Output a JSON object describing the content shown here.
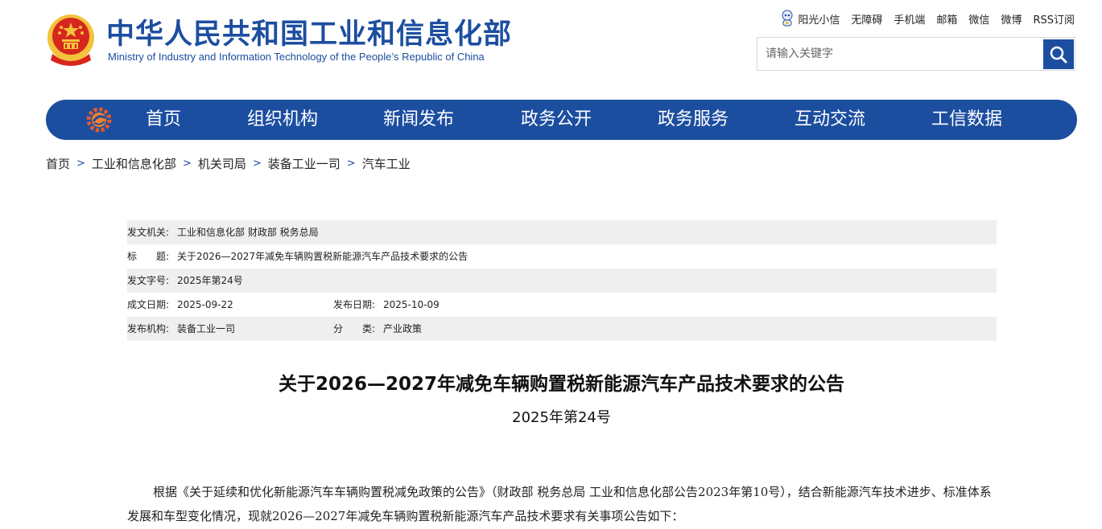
{
  "header": {
    "title": "中华人民共和国工业和信息化部",
    "subtitle": "Ministry of Industry and Information Technology of the People’s Republic of China",
    "top_links": [
      "阳光小信",
      "无障碍",
      "手机端",
      "邮箱",
      "微信",
      "微博",
      "RSS订阅"
    ],
    "search_placeholder": "请输入关键字"
  },
  "nav": {
    "items": [
      "首页",
      "组织机构",
      "新闻发布",
      "政务公开",
      "政务服务",
      "互动交流",
      "工信数据"
    ]
  },
  "breadcrumb": [
    "首页",
    "工业和信息化部",
    "机关司局",
    "装备工业一司",
    "汽车工业"
  ],
  "meta": {
    "issuer_label": "发文机关:",
    "issuer": "工业和信息化部 财政部 税务总局",
    "title_label": "标　　题:",
    "title": "关于2026—2027年减免车辆购置税新能源汽车产品技术要求的公告",
    "docno_label": "发文字号:",
    "docno": "2025年第24号",
    "written_label": "成文日期:",
    "written": "2025-09-22",
    "published_label": "发布日期:",
    "published": "2025-10-09",
    "agency_label": "发布机构:",
    "agency": "装备工业一司",
    "category_label": "分　　类:",
    "category": "产业政策"
  },
  "article": {
    "title": "关于2026—2027年减免车辆购置税新能源汽车产品技术要求的公告",
    "number": "2025年第24号",
    "body": "根据《关于延续和优化新能源汽车车辆购置税减免政策的公告》（财政部 税务总局 工业和信息化部公告2023年第10号），结合新能源汽车技术进步、标准体系发展和车型变化情况，现就2026—2027年减免车辆购置税新能源汽车产品技术要求有关事项公告如下："
  },
  "colors": {
    "brand_blue": "#1c4ea0",
    "emblem_red": "#d7261d",
    "emblem_gold": "#f3c33b",
    "meta_shade": "#efefef"
  }
}
